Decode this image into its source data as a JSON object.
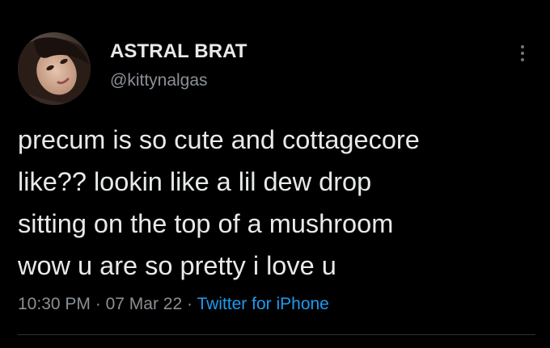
{
  "tweet": {
    "author": {
      "display_name": "ASTRAL BRAT",
      "handle": "@kittynalgas",
      "avatar_icon": "user-avatar-photo"
    },
    "text_lines": [
      "precum is so cute and cottagecore",
      "like?? lookin like a lil dew drop",
      "sitting on the top of a mushroom",
      "wow u are so pretty i love u"
    ],
    "meta": {
      "time": "10:30 PM",
      "separator": "·",
      "date": "07 Mar 22",
      "source": "Twitter for iPhone"
    },
    "more_icon": "vertical-ellipsis-icon"
  },
  "colors": {
    "background": "#000000",
    "primary_text": "#e7e9ea",
    "secondary_text": "#8b9095",
    "link": "#1d9bf0",
    "divider": "#2f3336"
  }
}
